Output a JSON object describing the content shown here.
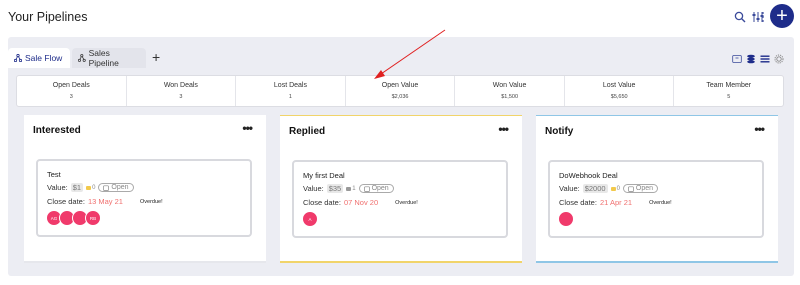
{
  "header": {
    "title": "Your Pipelines"
  },
  "tabs": [
    {
      "label": "Sale Flow",
      "active": true
    },
    {
      "label": "Sales Pipeline",
      "active": false
    }
  ],
  "stats": [
    {
      "label": "Open Deals",
      "value": "3"
    },
    {
      "label": "Won Deals",
      "value": "3"
    },
    {
      "label": "Lost Deals",
      "value": "1"
    },
    {
      "label": "Open Value",
      "value": "$2,036"
    },
    {
      "label": "Won Value",
      "value": "$1,500"
    },
    {
      "label": "Lost Value",
      "value": "$5,650"
    },
    {
      "label": "Team Member",
      "value": "5"
    }
  ],
  "columns": [
    {
      "title": "Interested",
      "card": {
        "title": "Test",
        "value_label": "Value:",
        "amount": "$1",
        "count": "0",
        "status": "Open",
        "close_label": "Close date:",
        "close_date": "13 May 21",
        "overdue": "Overdue!",
        "avatars": [
          "AG",
          "",
          "",
          "RB"
        ]
      }
    },
    {
      "title": "Replied",
      "card": {
        "title": "My first Deal",
        "value_label": "Value:",
        "amount": "$35",
        "count": "1",
        "status": "Open",
        "close_label": "Close date:",
        "close_date": "07 Nov 20",
        "overdue": "Overdue!",
        "avatars": [
          "A"
        ]
      }
    },
    {
      "title": "Notify",
      "card": {
        "title": "DoWebhook Deal",
        "value_label": "Value:",
        "amount": "$2000",
        "count": "0",
        "status": "Open",
        "close_label": "Close date:",
        "close_date": "21 Apr 21",
        "overdue": "Overdue!",
        "avatars": [
          ""
        ]
      }
    }
  ],
  "colors": {
    "primary": "#1e2c8a",
    "avatar": "#f03a6b",
    "overdue_date": "#f0706f",
    "replied_accent": "#f1d46a",
    "notify_accent": "#8fc6e6",
    "annotation_arrow": "#e02020"
  },
  "icons": {
    "search": "search-icon",
    "filter": "sliders-icon",
    "more": "vertical-dots-icon",
    "add": "plus-icon",
    "pipeline": "pipeline-icon",
    "views": [
      "kanban-icon",
      "stack-icon",
      "list-icon",
      "gear-icon"
    ]
  }
}
